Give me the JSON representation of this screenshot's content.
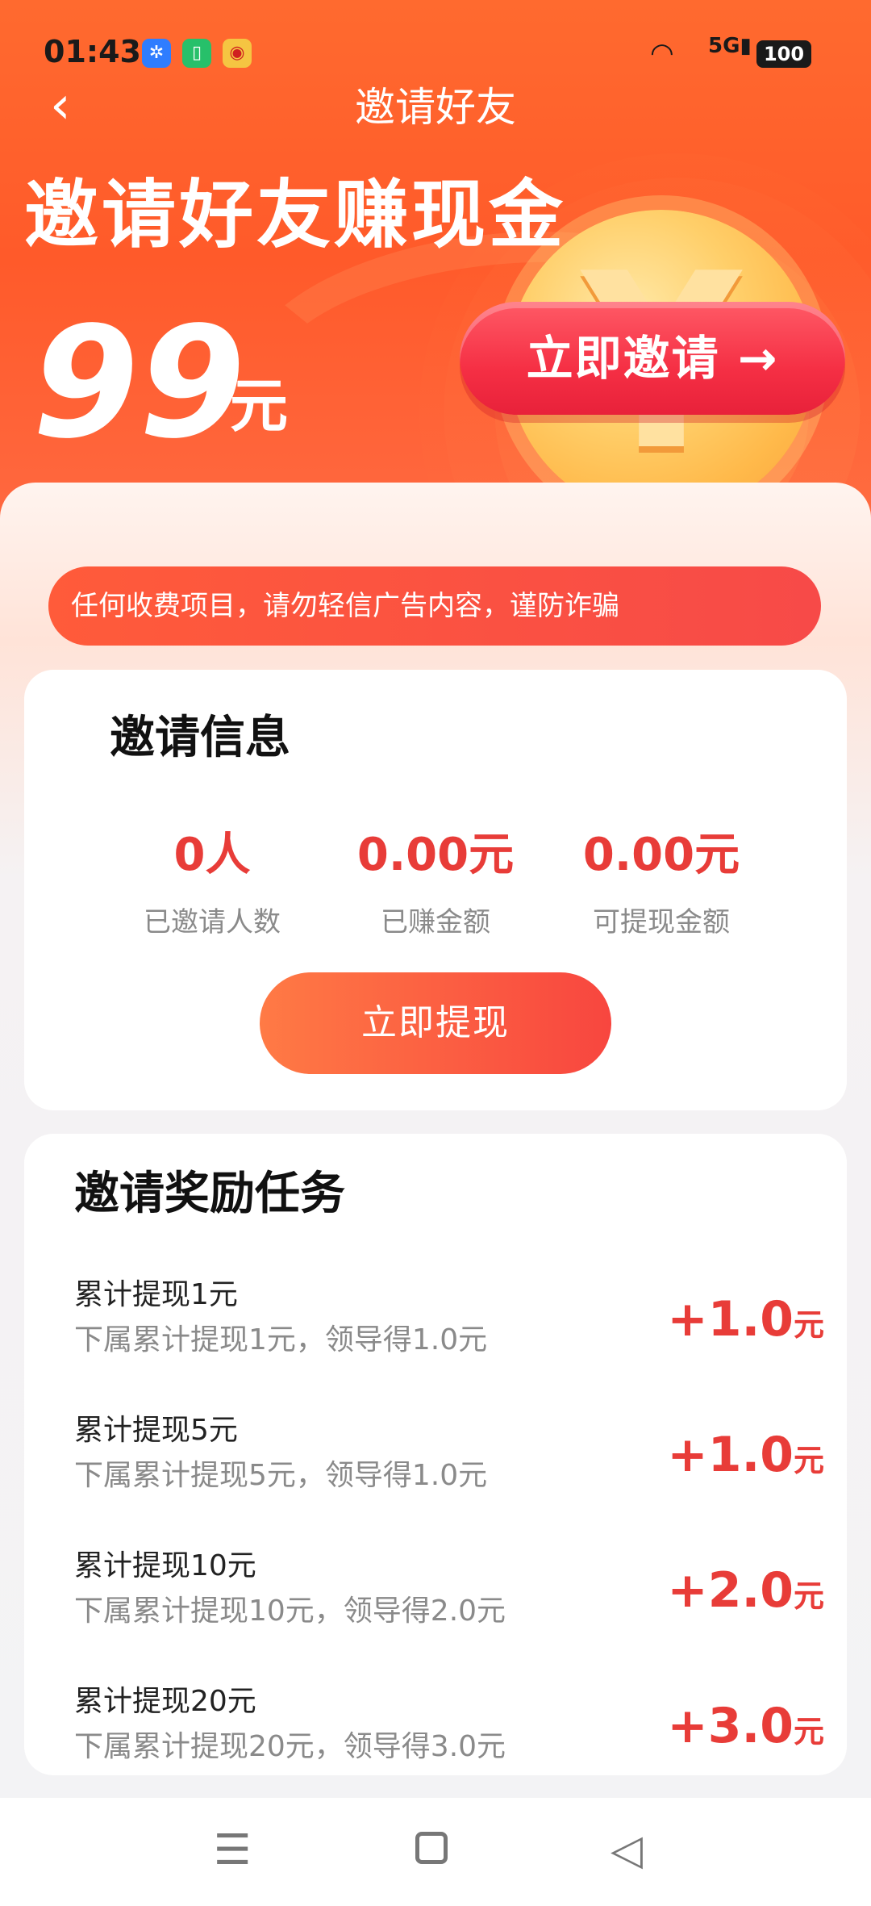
{
  "status_bar": {
    "time": "01:43",
    "network": "5G",
    "battery": "100",
    "apps": [
      "pinwheel-app-icon",
      "battery-saver-app-icon",
      "weibo-app-icon"
    ]
  },
  "nav": {
    "title": "邀请好友",
    "back_glyph": "‹"
  },
  "hero": {
    "title": "邀请好友赚现金",
    "amount": "99",
    "unit": "元",
    "invite_button": "立即邀请 →"
  },
  "notice": {
    "text": "任何收费项目，请勿轻信广告内容，谨防诈骗"
  },
  "invite_info": {
    "title": "邀请信息",
    "stats": [
      {
        "value": "0人",
        "label": "已邀请人数"
      },
      {
        "value": "0.00元",
        "label": "已赚金额"
      },
      {
        "value": "0.00元",
        "label": "可提现金额"
      }
    ],
    "withdraw_button": "立即提现"
  },
  "tasks": {
    "title": "邀请奖励任务",
    "items": [
      {
        "title": "累计提现1元",
        "desc": "下属累计提现1元，领导得1.0元",
        "reward": "+1.0",
        "unit": "元"
      },
      {
        "title": "累计提现5元",
        "desc": "下属累计提现5元，领导得1.0元",
        "reward": "+1.0",
        "unit": "元"
      },
      {
        "title": "累计提现10元",
        "desc": "下属累计提现10元，领导得2.0元",
        "reward": "+2.0",
        "unit": "元"
      },
      {
        "title": "累计提现20元",
        "desc": "下属累计提现20元，领导得3.0元",
        "reward": "+3.0",
        "unit": "元"
      }
    ]
  },
  "colors": {
    "hero_orange": "#ff6a2f",
    "accent_red": "#e83c38",
    "button_red": "#f52f44"
  }
}
